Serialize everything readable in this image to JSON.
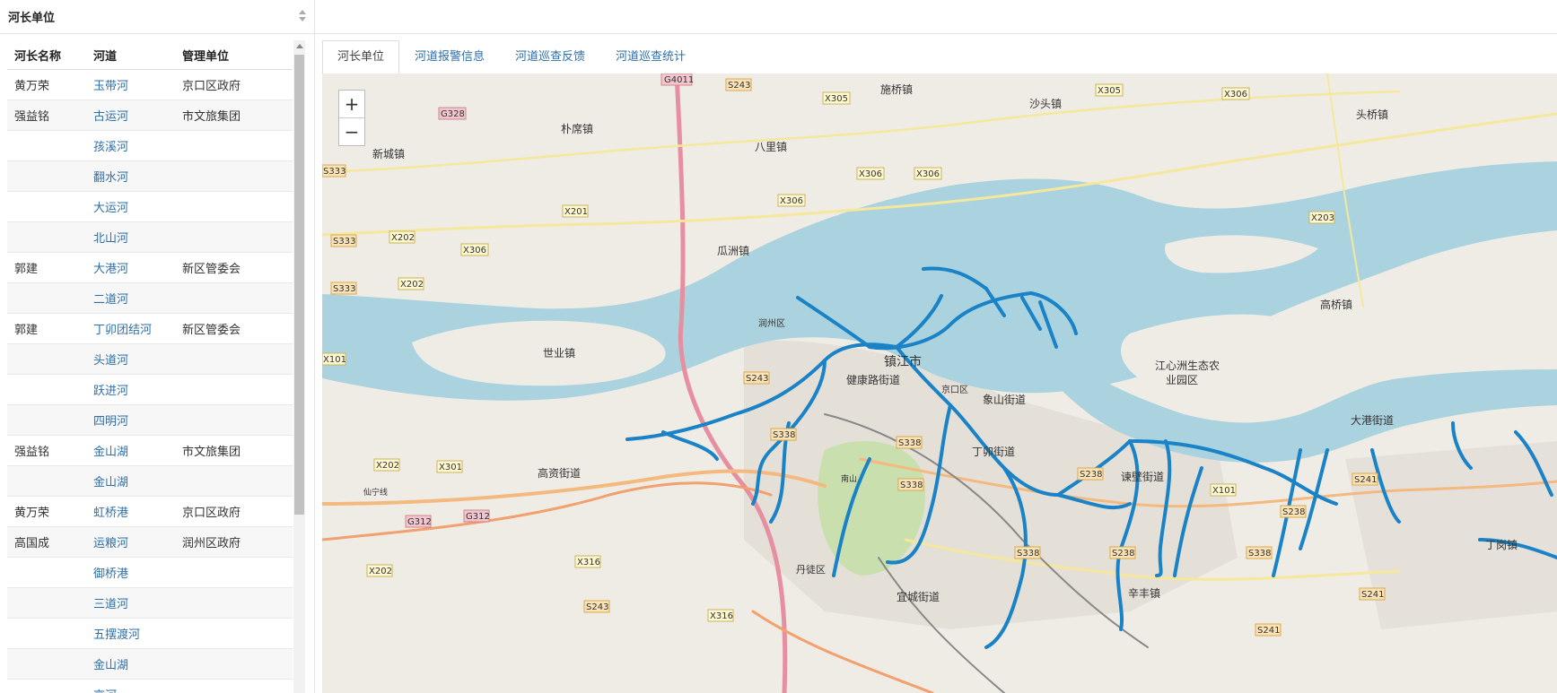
{
  "left_panel": {
    "title": "河长单位",
    "columns": [
      "河长名称",
      "河道",
      "管理单位"
    ],
    "rows": [
      {
        "chief": "黄万荣",
        "river": "玉带河",
        "unit": "京口区政府"
      },
      {
        "chief": "强益铭",
        "river": "古运河",
        "unit": "市文旅集团"
      },
      {
        "chief": "",
        "river": "孩溪河",
        "unit": ""
      },
      {
        "chief": "",
        "river": "翻水河",
        "unit": ""
      },
      {
        "chief": "",
        "river": "大运河",
        "unit": ""
      },
      {
        "chief": "",
        "river": "北山河",
        "unit": ""
      },
      {
        "chief": "郭建",
        "river": "大港河",
        "unit": "新区管委会"
      },
      {
        "chief": "",
        "river": "二道河",
        "unit": ""
      },
      {
        "chief": "郭建",
        "river": "丁卯团结河",
        "unit": "新区管委会"
      },
      {
        "chief": "",
        "river": "头道河",
        "unit": ""
      },
      {
        "chief": "",
        "river": "跃进河",
        "unit": ""
      },
      {
        "chief": "",
        "river": "四明河",
        "unit": ""
      },
      {
        "chief": "强益铭",
        "river": "金山湖",
        "unit": "市文旅集团"
      },
      {
        "chief": "",
        "river": "金山湖",
        "unit": ""
      },
      {
        "chief": "黄万荣",
        "river": "虹桥港",
        "unit": "京口区政府"
      },
      {
        "chief": "高国成",
        "river": "运粮河",
        "unit": "润州区政府"
      },
      {
        "chief": "",
        "river": "御桥港",
        "unit": ""
      },
      {
        "chief": "",
        "river": "三道河",
        "unit": ""
      },
      {
        "chief": "",
        "river": "五摆渡河",
        "unit": ""
      },
      {
        "chief": "",
        "river": "金山湖",
        "unit": ""
      },
      {
        "chief": "",
        "river": "京河",
        "unit": ""
      }
    ]
  },
  "tabs": [
    "河长单位",
    "河道报警信息",
    "河道巡查反馈",
    "河道巡查统计"
  ],
  "active_tab": 0,
  "map": {
    "zoom_in": "+",
    "zoom_out": "−",
    "places": {
      "zhenjiang": "镇江市",
      "guazhou": "瓜洲镇",
      "bali": "八里镇",
      "puxi": "朴席镇",
      "xincheng": "新城镇",
      "shiqiao": "施桥镇",
      "shatou": "沙头镇",
      "touqiao": "头桥镇",
      "shiye": "世业镇",
      "jiankang": "健康路街道",
      "jingkou": "京口区",
      "xiangshan": "象山街道",
      "dingmao": "丁卯街道",
      "gaozi": "高资街道",
      "jiangxinzhou": "江心洲生态农",
      "jiangxinzhou2": "业园区",
      "gaoqiao": "高桥镇",
      "dagang": "大港街道",
      "dingang": "丁岗镇",
      "dantu": "丹徒区",
      "yicheng": "宜城街道",
      "xinfeng": "辛丰镇",
      "jianbi": "谏壁街道",
      "runzhou": "润州区",
      "nanshan": "南山",
      "xianning": "仙宁线"
    },
    "shields": [
      "G4011",
      "S243",
      "X305",
      "X305",
      "X306",
      "G328",
      "S333",
      "X306",
      "X306",
      "X306",
      "X201",
      "X202",
      "S333",
      "X306",
      "X202",
      "S333",
      "X101",
      "S243",
      "S338",
      "S338",
      "X202",
      "X301",
      "G312",
      "G312",
      "S338",
      "S238",
      "S338",
      "S238",
      "X101",
      "S238",
      "S338",
      "S241",
      "X203",
      "X316",
      "S243",
      "X316",
      "X202",
      "S241",
      "S241"
    ]
  },
  "colors": {
    "water": "#aad3df",
    "river_path": "#1a82c6",
    "link": "#2e6fa8",
    "land": "#efece6"
  }
}
